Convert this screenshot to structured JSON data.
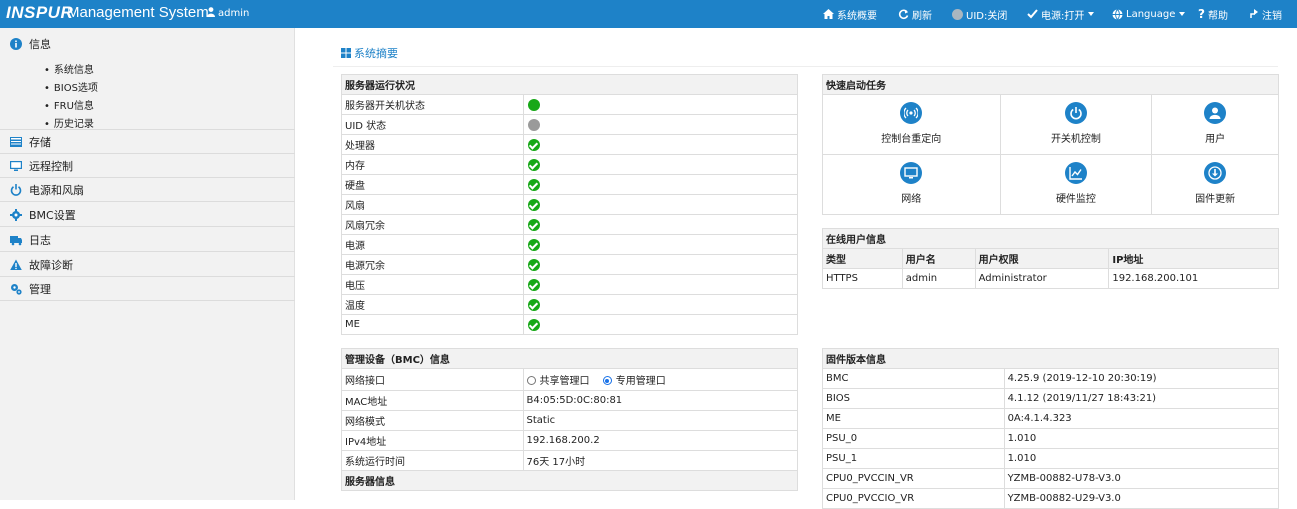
{
  "header": {
    "logo": "INSPUR",
    "title": "Management System",
    "user": "admin",
    "nav": {
      "overview": "系统概要",
      "refresh": "刷新",
      "uid": "UID:关闭",
      "power": "电源:打开",
      "language": "Language",
      "help": "帮助",
      "logout": "注销"
    }
  },
  "sidebar": {
    "info": "信息",
    "info_sub": [
      "系统信息",
      "BIOS选项",
      "FRU信息",
      "历史记录"
    ],
    "storage": "存储",
    "remote": "远程控制",
    "power_fan": "电源和风扇",
    "bmc": "BMC设置",
    "log": "日志",
    "diag": "故障诊断",
    "manage": "管理"
  },
  "page": {
    "title": "系统摘要"
  },
  "server_status": {
    "title": "服务器运行状况",
    "rows": [
      {
        "label": "服务器开关机状态",
        "state": "on"
      },
      {
        "label": "UID 状态",
        "state": "off"
      },
      {
        "label": "处理器",
        "state": "ok"
      },
      {
        "label": "内存",
        "state": "ok"
      },
      {
        "label": "硬盘",
        "state": "ok"
      },
      {
        "label": "风扇",
        "state": "ok"
      },
      {
        "label": "风扇冗余",
        "state": "ok"
      },
      {
        "label": "电源",
        "state": "ok"
      },
      {
        "label": "电源冗余",
        "state": "ok"
      },
      {
        "label": "电压",
        "state": "ok"
      },
      {
        "label": "温度",
        "state": "ok"
      },
      {
        "label": "ME",
        "state": "ok"
      }
    ]
  },
  "quick_tasks": {
    "title": "快速启动任务",
    "items": [
      "控制台重定向",
      "开关机控制",
      "用户",
      "网络",
      "硬件监控",
      "固件更新"
    ]
  },
  "online_users": {
    "title": "在线用户信息",
    "headers": [
      "类型",
      "用户名",
      "用户权限",
      "IP地址"
    ],
    "rows": [
      [
        "HTTPS",
        "admin",
        "Administrator",
        "192.168.200.101"
      ]
    ]
  },
  "bmc_info": {
    "title": "管理设备（BMC）信息",
    "network_label": "网络接口",
    "shared_port": "共享管理口",
    "dedicated_port": "专用管理口",
    "rows": [
      [
        "MAC地址",
        "B4:05:5D:0C:80:81"
      ],
      [
        "网络模式",
        "Static"
      ],
      [
        "IPv4地址",
        "192.168.200.2"
      ],
      [
        "系统运行时间",
        "76天 17小时"
      ]
    ],
    "server_info_title": "服务器信息"
  },
  "firmware": {
    "title": "固件版本信息",
    "rows": [
      [
        "BMC",
        "4.25.9 (2019-12-10 20:30:19)"
      ],
      [
        "BIOS",
        "4.1.12 (2019/11/27 18:43:21)"
      ],
      [
        "ME",
        "0A:4.1.4.323"
      ],
      [
        "PSU_0",
        "1.010"
      ],
      [
        "PSU_1",
        "1.010"
      ],
      [
        "CPU0_PVCCIN_VR",
        "YZMB-00882-U78-V3.0"
      ],
      [
        "CPU0_PVCCIO_VR",
        "YZMB-00882-U29-V3.0"
      ]
    ]
  },
  "colors": {
    "brand": "#1e82c8",
    "ok": "#18a818",
    "off": "#9a9a9a"
  }
}
